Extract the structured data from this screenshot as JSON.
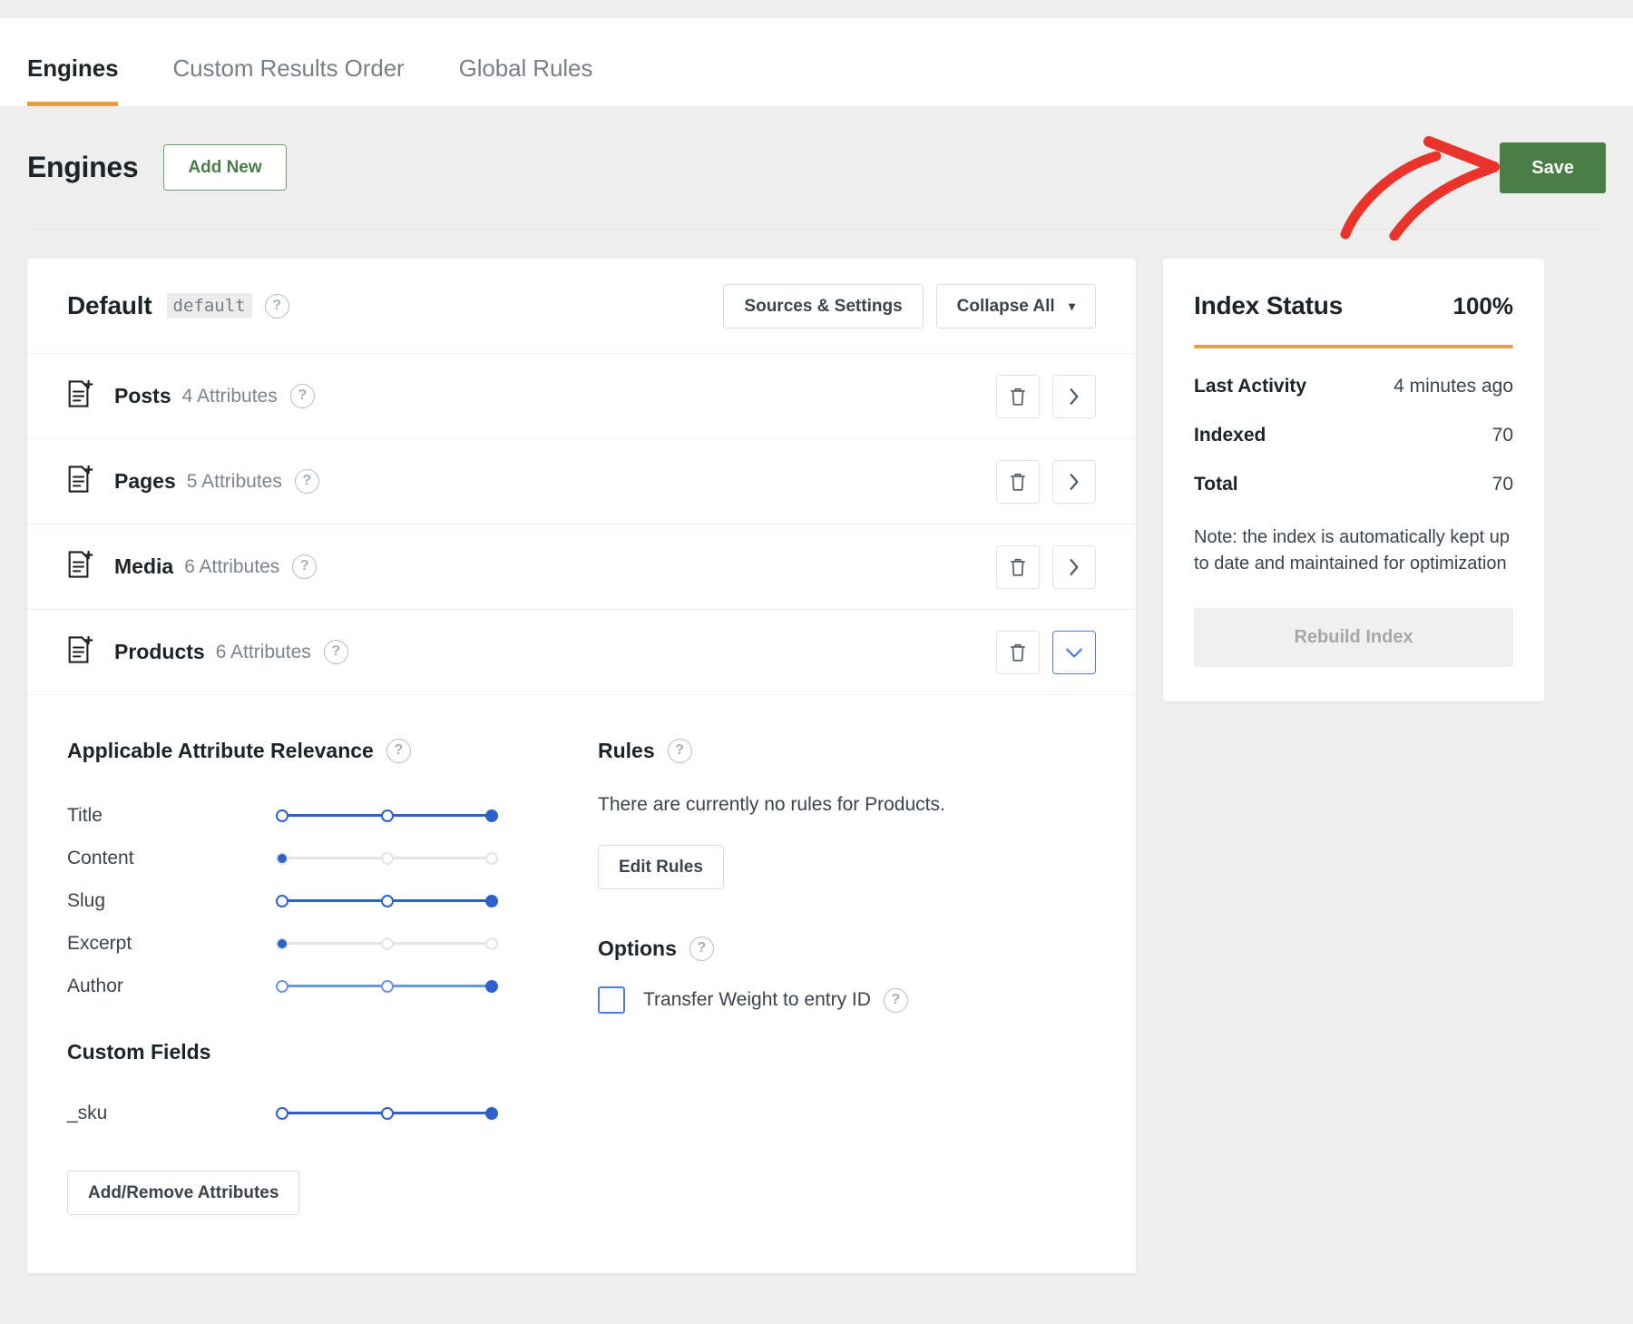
{
  "tabs": [
    {
      "label": "Engines",
      "active": true
    },
    {
      "label": "Custom Results Order",
      "active": false
    },
    {
      "label": "Global Rules",
      "active": false
    }
  ],
  "page_header": {
    "title": "Engines",
    "add_new_label": "Add New",
    "save_label": "Save"
  },
  "engine": {
    "name": "Default",
    "slug": "default",
    "sources_settings_label": "Sources & Settings",
    "collapse_all_label": "Collapse All",
    "post_types": [
      {
        "name": "Posts",
        "attributes": "4 Attributes",
        "expanded": false
      },
      {
        "name": "Pages",
        "attributes": "5 Attributes",
        "expanded": false
      },
      {
        "name": "Media",
        "attributes": "6 Attributes",
        "expanded": false
      },
      {
        "name": "Products",
        "attributes": "6 Attributes",
        "expanded": true
      }
    ]
  },
  "relevance": {
    "title": "Applicable Attribute Relevance",
    "sliders": [
      {
        "label": "Title",
        "value": 2,
        "max": 2
      },
      {
        "label": "Content",
        "value": 0,
        "max": 2
      },
      {
        "label": "Slug",
        "value": 2,
        "max": 2
      },
      {
        "label": "Excerpt",
        "value": 0,
        "max": 2
      },
      {
        "label": "Author",
        "value": 2,
        "max": 2
      }
    ],
    "custom_fields_title": "Custom Fields",
    "custom_fields": [
      {
        "label": "_sku",
        "value": 2,
        "max": 2
      }
    ],
    "add_remove_label": "Add/Remove Attributes"
  },
  "rules": {
    "title": "Rules",
    "empty_text": "There are currently no rules for Products.",
    "edit_label": "Edit Rules"
  },
  "options": {
    "title": "Options",
    "transfer_weight_label": "Transfer Weight to entry ID",
    "transfer_weight_checked": false
  },
  "index_status": {
    "title": "Index Status",
    "percent": "100%",
    "progress_value": 100,
    "stats": [
      {
        "key": "Last Activity",
        "value": "4 minutes ago"
      },
      {
        "key": "Indexed",
        "value": "70"
      },
      {
        "key": "Total",
        "value": "70"
      }
    ],
    "note": "Note: the index is automatically kept up to date and maintained for optimization",
    "rebuild_label": "Rebuild Index",
    "rebuild_disabled": true
  },
  "colors": {
    "accent_orange": "#e2a03f",
    "save_green": "#4a7d46",
    "add_new_green": "#4a7c4a",
    "slider_blue": "#2e62c8",
    "annotation_red": "#e8342a"
  }
}
